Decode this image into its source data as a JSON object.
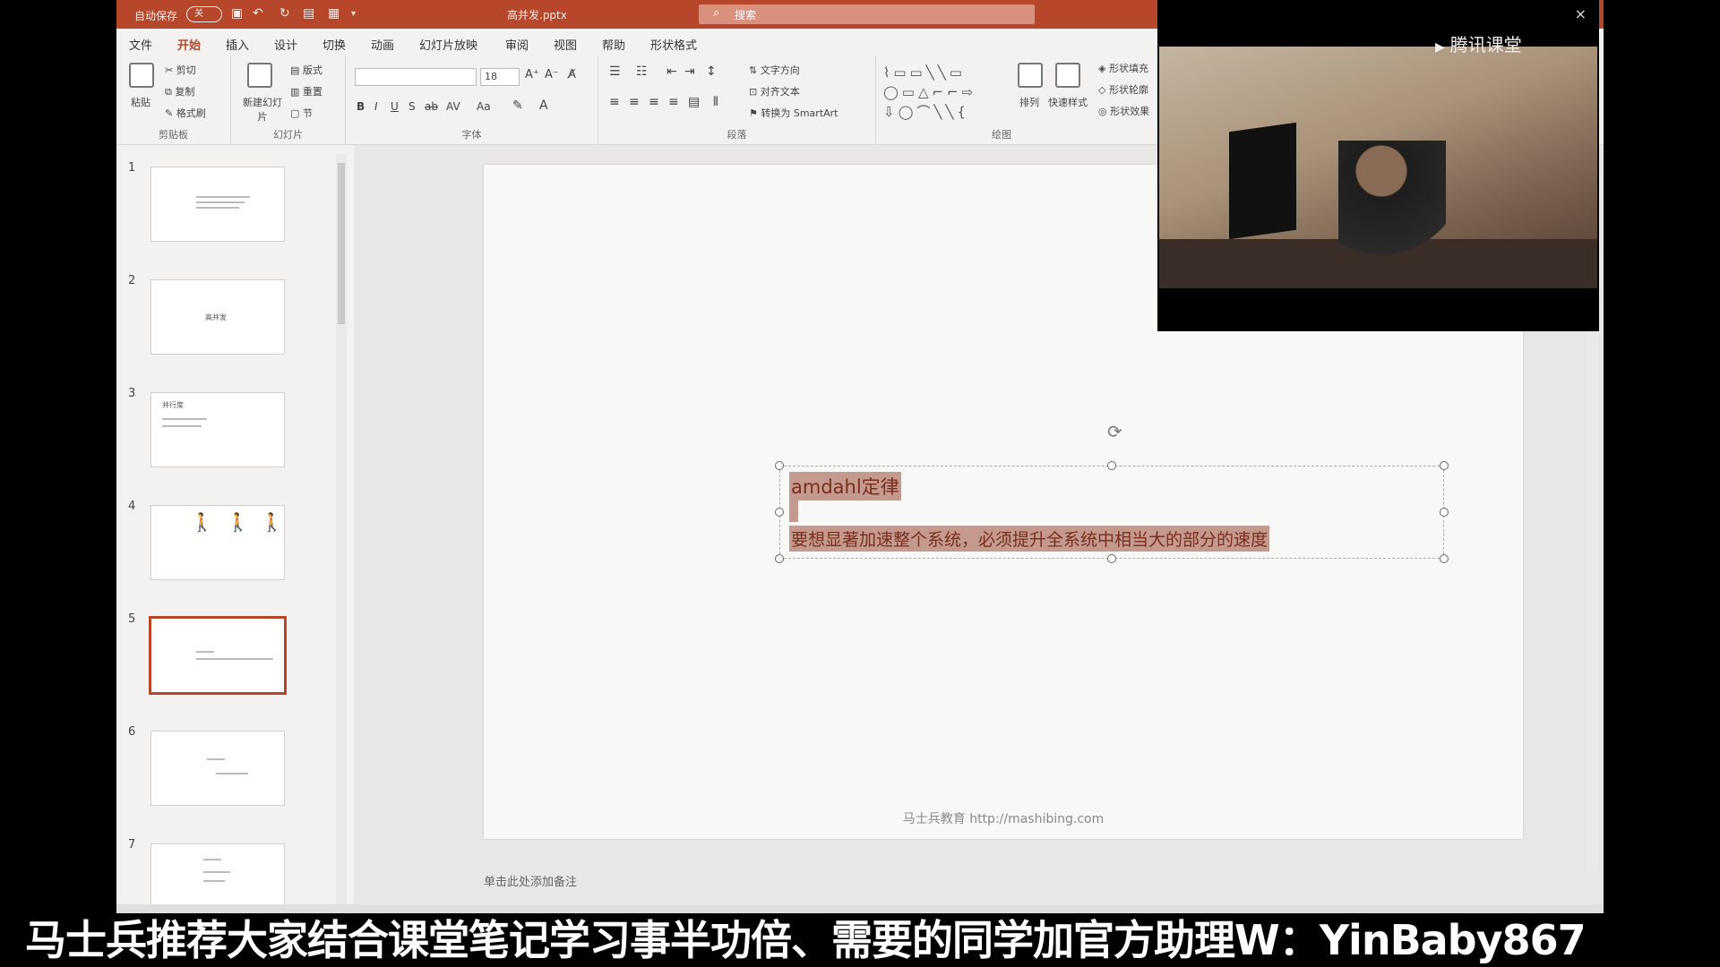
{
  "window": {
    "autosave_label": "自动保存",
    "autosave_state": "关",
    "filename": "高并发.pptx",
    "search_placeholder": "搜索"
  },
  "tabs": [
    {
      "label": "文件"
    },
    {
      "label": "开始"
    },
    {
      "label": "插入"
    },
    {
      "label": "设计"
    },
    {
      "label": "切换"
    },
    {
      "label": "动画"
    },
    {
      "label": "幻灯片放映"
    },
    {
      "label": "审阅"
    },
    {
      "label": "视图"
    },
    {
      "label": "帮助"
    },
    {
      "label": "形状格式"
    }
  ],
  "ribbon": {
    "clipboard": {
      "paste": "粘贴",
      "cut": "剪切",
      "copy": "复制",
      "format_painter": "格式刷",
      "label": "剪贴板"
    },
    "slides": {
      "new_slide": "新建幻灯片",
      "layout": "版式",
      "reset": "重置",
      "section": "节",
      "label": "幻灯片"
    },
    "font": {
      "size": "18",
      "bold": "B",
      "italic": "I",
      "underline": "U",
      "shadow": "S",
      "strike": "ab",
      "spacing": "AV",
      "case": "Aa",
      "label": "字体"
    },
    "paragraph": {
      "text_direction": "文字方向",
      "align_text": "对齐文本",
      "smartart": "转换为 SmartArt",
      "label": "段落"
    },
    "drawing": {
      "arrange": "排列",
      "quick_styles": "快速样式",
      "shape_fill": "形状填充",
      "shape_outline": "形状轮廓",
      "shape_effects": "形状效果",
      "label": "绘图"
    }
  },
  "thumbnails": [
    {
      "number": "1"
    },
    {
      "number": "2",
      "title": "高并发"
    },
    {
      "number": "3",
      "title": "并行度"
    },
    {
      "number": "4"
    },
    {
      "number": "5"
    },
    {
      "number": "6"
    },
    {
      "number": "7"
    }
  ],
  "slide": {
    "title": "amdahl定律",
    "body": "要想显著加速整个系统，必须提升全系统中相当大的部分的速度",
    "footer": "马士兵教育 http://mashibing.com"
  },
  "notes_placeholder": "单击此处添加备注",
  "overlay": {
    "brand": "腾讯课堂",
    "close": "×"
  },
  "subtitle": "马士兵推荐大家结合课堂笔记学习事半功倍、需要的同学加官方助理W：YinBaby867"
}
